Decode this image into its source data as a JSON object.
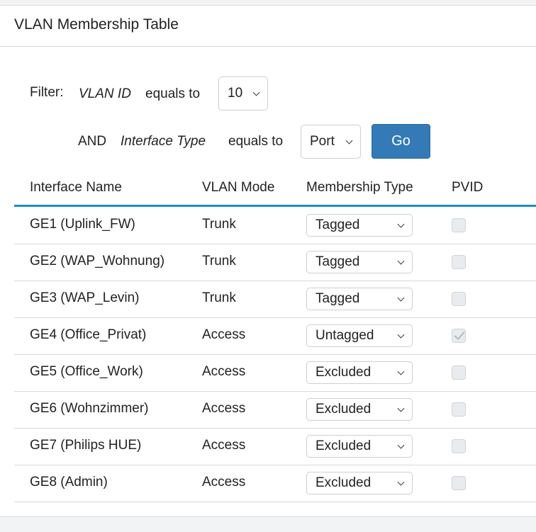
{
  "title": "VLAN Membership Table",
  "filter": {
    "label": "Filter:",
    "field1": "VLAN ID",
    "op1": "equals to",
    "value1": "10",
    "and": "AND",
    "field2": "Interface Type",
    "op2": "equals to",
    "value2": "Port",
    "go_label": "Go"
  },
  "colors": {
    "accent": "#337ab7",
    "header_rule": "#1c8dbf"
  },
  "table": {
    "headers": [
      "Interface Name",
      "VLAN Mode",
      "Membership Type",
      "PVID"
    ],
    "rows": [
      {
        "name": "GE1 (Uplink_FW)",
        "mode": "Trunk",
        "membership": "Tagged",
        "pvid": false
      },
      {
        "name": "GE2 (WAP_Wohnung)",
        "mode": "Trunk",
        "membership": "Tagged",
        "pvid": false
      },
      {
        "name": "GE3 (WAP_Levin)",
        "mode": "Trunk",
        "membership": "Tagged",
        "pvid": false
      },
      {
        "name": "GE4 (Office_Privat)",
        "mode": "Access",
        "membership": "Untagged",
        "pvid": true
      },
      {
        "name": "GE5 (Office_Work)",
        "mode": "Access",
        "membership": "Excluded",
        "pvid": false
      },
      {
        "name": "GE6 (Wohnzimmer)",
        "mode": "Access",
        "membership": "Excluded",
        "pvid": false
      },
      {
        "name": "GE7 (Philips HUE)",
        "mode": "Access",
        "membership": "Excluded",
        "pvid": false
      },
      {
        "name": "GE8 (Admin)",
        "mode": "Access",
        "membership": "Excluded",
        "pvid": false
      }
    ]
  }
}
